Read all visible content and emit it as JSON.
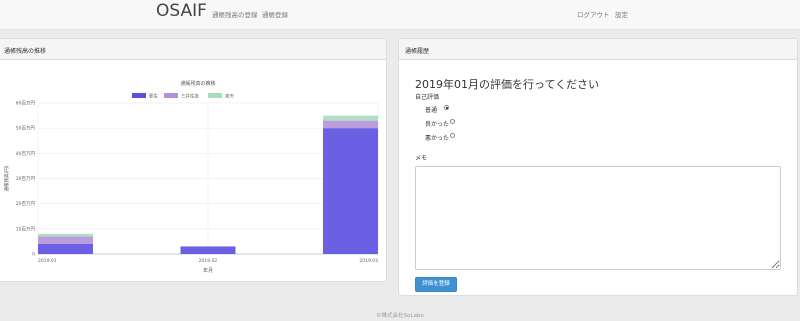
{
  "navbar": {
    "brand": "OSAIF",
    "links": [
      "通帳残高の登録",
      "通帳登録"
    ],
    "right_links": [
      "ログアウト",
      "設定"
    ]
  },
  "balance_panel": {
    "heading": "通帳残高の推移"
  },
  "chart_data": {
    "type": "bar",
    "stacked": true,
    "title": "通帳残高の推移",
    "categories": [
      "2019.01",
      "2019.02",
      "2019.03"
    ],
    "series": [
      {
        "name": "郵生",
        "color": "#5b4fe0",
        "values": [
          4,
          3,
          50
        ]
      },
      {
        "name": "三井住友",
        "color": "#b592d8",
        "values": [
          3,
          0,
          3
        ]
      },
      {
        "name": "楽天",
        "color": "#a8dcbc",
        "values": [
          1,
          0,
          2
        ]
      }
    ],
    "xlabel": "年月",
    "ylabel": "通帳残高(円)",
    "ylim": [
      0,
      60
    ],
    "yticks": [
      "0",
      "10百万円",
      "20百万円",
      "30百万円",
      "40百万円",
      "50百万円",
      "60百万円"
    ],
    "grid": true,
    "legend": "top"
  },
  "eval_panel": {
    "heading": "通帳履歴",
    "title": "2019年01月の評価を行ってください",
    "self_eval_label": "自己評価",
    "options": [
      {
        "label": "普通",
        "selected": true
      },
      {
        "label": "良かった",
        "selected": false
      },
      {
        "label": "悪かった",
        "selected": false
      }
    ],
    "memo_label": "メモ",
    "memo_value": "",
    "submit_label": "評価を登録"
  },
  "footer": {
    "text": "©株式会社SoLabo"
  }
}
